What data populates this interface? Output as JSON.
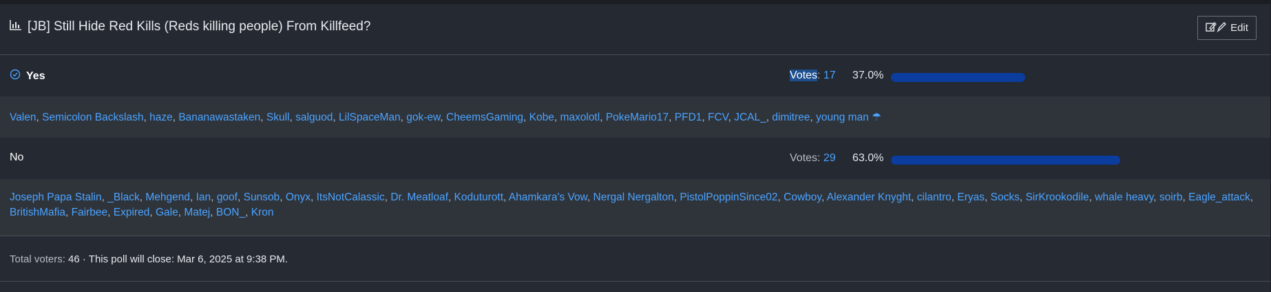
{
  "poll": {
    "title": "[JB] Still Hide Red Kills (Reds killing people) From Killfeed?",
    "edit_label": "Edit",
    "options": [
      {
        "label": "Yes",
        "votes_label": "Votes",
        "votes": "17",
        "percent": "37.0%",
        "fraction": 0.37,
        "voters": [
          "Valen",
          "Semicolon Backslash",
          "haze",
          "Bananawastaken",
          "Skull",
          "salguod",
          "LilSpaceMan",
          "gok-ew",
          "CheemsGaming",
          "Kobe",
          "maxolotl",
          "PokeMario17",
          "PFD1",
          "FCV",
          "JCAL_",
          "dimitree",
          "young man ☂"
        ]
      },
      {
        "label": "No",
        "votes_label": "Votes",
        "votes": "29",
        "percent": "63.0%",
        "fraction": 0.63,
        "voters": [
          "Joseph Papa Stalin",
          "_Black",
          "Mehgend",
          "Ian",
          "goof",
          "Sunsob",
          "Onyx",
          "ItsNotCalassic",
          "Dr. Meatloaf",
          "Koduturott",
          "Ahamkara's Vow",
          "Nergal Nergalton",
          "PistolPoppinSince02",
          "Cowboy",
          "Alexander Knyght",
          "cilantro",
          "Eryas",
          "Socks",
          "SirKrookodile",
          "whale heavy",
          "soirb",
          "Eagle_attack",
          "BritishMafia",
          "Fairbee",
          "Expired",
          "Gale",
          "Matej",
          "BON_",
          "Kron"
        ]
      }
    ],
    "footer": {
      "total_label": "Total voters:",
      "total": "46",
      "close_text": "· This poll will close: Mar 6, 2025 at 9:38 PM."
    }
  },
  "colors": {
    "accent": "#4ba3ff",
    "bar": "#0b3d9f",
    "background": "#262b33"
  },
  "icons": {
    "title_icon": "bar-chart-icon",
    "edit_icon": "edit-icon",
    "selected_icon": "check-circle-icon"
  }
}
